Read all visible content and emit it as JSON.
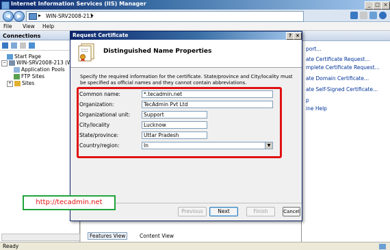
{
  "window": {
    "title": "Internet Information Services (IIS) Manager",
    "controls": [
      "_",
      "□",
      "×"
    ]
  },
  "address": {
    "path": "WIN-SRV2008-213",
    "separator": "▸"
  },
  "menu": [
    "File",
    "View",
    "Help"
  ],
  "connections": {
    "header": "Connections",
    "tree": [
      {
        "label": "Start Page"
      },
      {
        "label": "WIN-SRV2008-213 (WI"
      },
      {
        "label": "Application Pools"
      },
      {
        "label": "FTP Sites"
      },
      {
        "label": "Sites"
      }
    ]
  },
  "actions": {
    "items": [
      "port...",
      "ate Certificate Request...",
      "mplete Certificate Request...",
      "ate Domain Certificate...",
      "ate Self-Signed Certificate...",
      "p",
      "ine Help"
    ]
  },
  "views": {
    "features_view": "Features View",
    "content_view": "Content View"
  },
  "status": {
    "text": "Ready"
  },
  "dialog": {
    "title": "Request Certificate",
    "help_btn": "?",
    "close_btn": "×",
    "heading": "Distinguished Name Properties",
    "instructions": "Specify the required information for the certificate. State/province and City/locality must be specified as official names and they cannot contain abbreviations.",
    "fields": [
      {
        "label": "Common name:",
        "value": "*.tecadmin.net"
      },
      {
        "label": "Organization:",
        "value": "TecAdmin Pvt Ltd"
      },
      {
        "label": "Organizational unit:",
        "value": "Support"
      },
      {
        "label": "City/locality",
        "value": "Lucknow"
      },
      {
        "label": "State/province:",
        "value": "Uttar Pradesh"
      },
      {
        "label": "Country/region:",
        "value": "In"
      }
    ],
    "buttons": {
      "previous": "Previous",
      "next": "Next",
      "finish": "Finish",
      "cancel": "Cancel"
    }
  },
  "watermark": "http://tecadmin.net",
  "colors": {
    "highlight_box": "#e01010",
    "watermark_border": "#1fa33a",
    "title_bar": "#0a246a"
  }
}
